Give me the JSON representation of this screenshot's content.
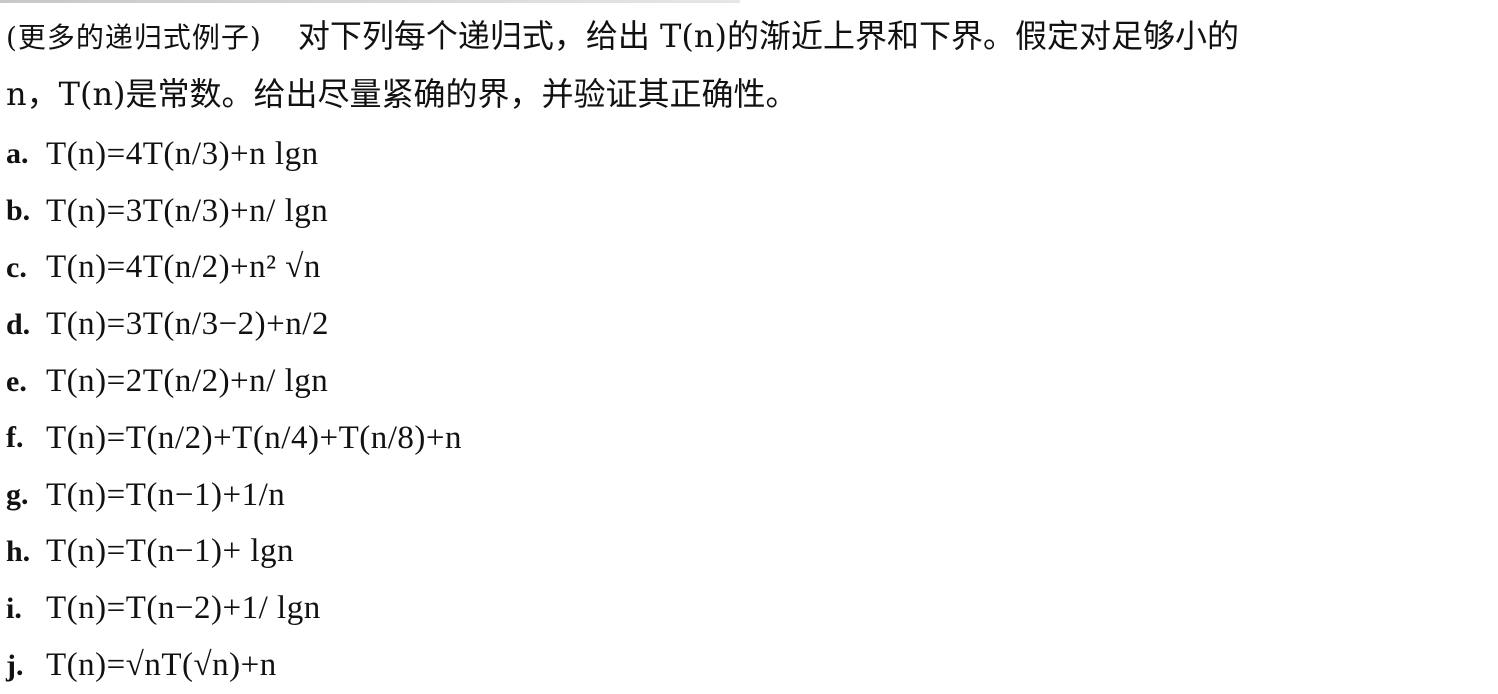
{
  "problem": {
    "tag": "(更多的递归式例子)",
    "line1": "对下列每个递归式，给出 T(n)的渐近上界和下界。假定对足够小的",
    "line2": "n，T(n)是常数。给出尽量紧确的界，并验证其正确性。"
  },
  "items": [
    {
      "label": "a.",
      "formula": "T(n)=4T(n/3)+n lgn"
    },
    {
      "label": "b.",
      "formula": "T(n)=3T(n/3)+n/ lgn"
    },
    {
      "label": "c.",
      "formula": "T(n)=4T(n/2)+n² √n"
    },
    {
      "label": "d.",
      "formula": "T(n)=3T(n/3−2)+n/2"
    },
    {
      "label": "e.",
      "formula": "T(n)=2T(n/2)+n/ lgn"
    },
    {
      "label": "f.",
      "formula": "T(n)=T(n/2)+T(n/4)+T(n/8)+n"
    },
    {
      "label": "g.",
      "formula": "T(n)=T(n−1)+1/n"
    },
    {
      "label": "h.",
      "formula": "T(n)=T(n−1)+ lgn"
    },
    {
      "label": "i.",
      "formula": "T(n)=T(n−2)+1/ lgn"
    },
    {
      "label": "j.",
      "formula": "T(n)=√nT(√n)+n"
    }
  ]
}
